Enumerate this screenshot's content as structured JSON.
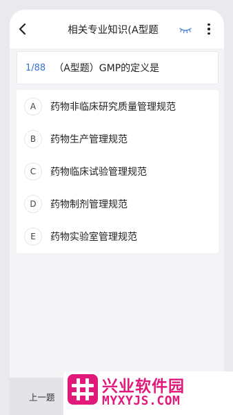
{
  "header": {
    "title": "相关专业知识(A型题",
    "back_icon": "chevron-left-icon",
    "eye_icon": "eye-closed-icon",
    "more_icon": "more-vertical-icon"
  },
  "question": {
    "number": "1/88",
    "text": "（A型题）GMP的定义是"
  },
  "options": [
    {
      "letter": "A",
      "text": "药物非临床研究质量管理规范"
    },
    {
      "letter": "B",
      "text": "药物生产管理规范"
    },
    {
      "letter": "C",
      "text": "药物临床试验管理规范"
    },
    {
      "letter": "D",
      "text": "药物制剂管理规范"
    },
    {
      "letter": "E",
      "text": "药物实验室管理规范"
    }
  ],
  "footer": {
    "prev_label": "上一题"
  },
  "watermark": {
    "name_cn": "兴业软件园",
    "name_en": "MYXYJS.COM",
    "accent": "#e0197a"
  },
  "colors": {
    "accent_blue": "#3c72ce",
    "eye_icon": "#4a7fd6"
  }
}
